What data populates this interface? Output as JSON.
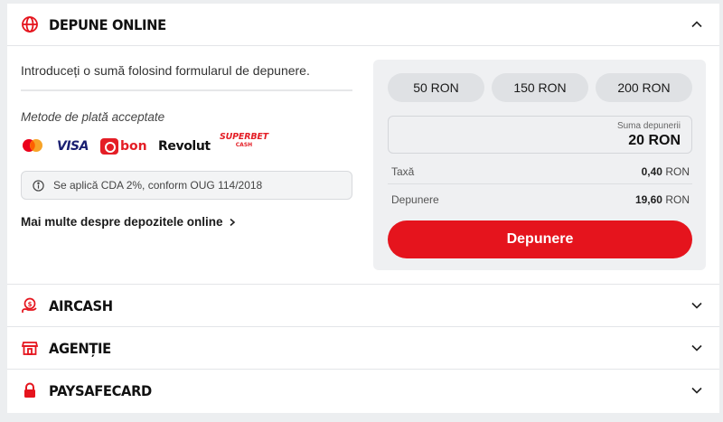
{
  "sections": {
    "depune_online": {
      "title": "DEPUNE ONLINE",
      "icon": "globe-icon",
      "expanded": true
    },
    "aircash": {
      "title": "AIRCASH",
      "icon": "coin-hand-icon"
    },
    "agentie": {
      "title": "AGENȚIE",
      "icon": "store-icon"
    },
    "paysafecard": {
      "title": "PAYSAFECARD",
      "icon": "lock-icon"
    }
  },
  "online": {
    "intro": "Introduceți o sumă folosind formularul de depunere.",
    "methods_label": "Metode de plată acceptate",
    "logos": {
      "visa": "VISA",
      "bon": "bon",
      "revolut": "Revolut",
      "superbet_top": "SUPERBET",
      "superbet_bottom": "CASH"
    },
    "info": "Se aplică CDA 2%, conform OUG 114/2018",
    "more_link": "Mai multe despre depozitele online"
  },
  "deposit_panel": {
    "chips": [
      "50  RON",
      "150  RON",
      "200  RON"
    ],
    "amount_label": "Suma depunerii",
    "amount_value": "20 RON",
    "fee_label": "Taxă",
    "fee_value": "0,40",
    "deposit_label": "Depunere",
    "deposit_value": "19,60",
    "currency": "RON",
    "button_label": "Depunere"
  },
  "colors": {
    "accent": "#e5141d",
    "panel_bg": "#eff0f2",
    "page_bg": "#eceef0"
  }
}
